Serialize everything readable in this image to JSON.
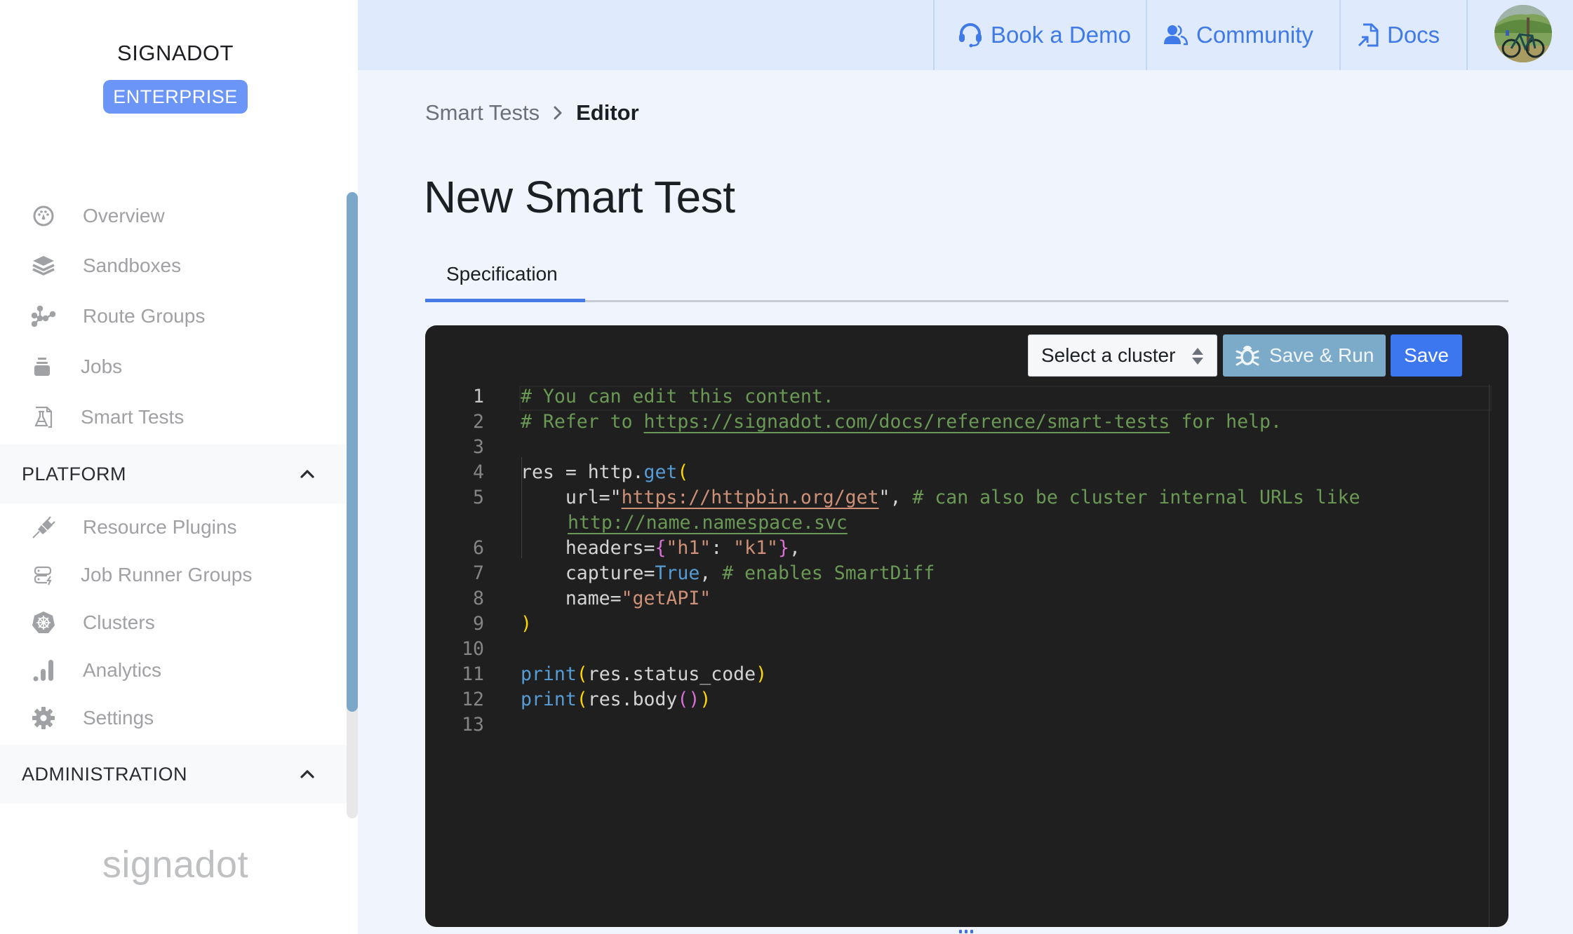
{
  "sidebar": {
    "brand": "SIGNADOT",
    "plan_badge": "ENTERPRISE",
    "items": [
      {
        "label": "Overview",
        "icon": "dashboard-gauge-icon"
      },
      {
        "label": "Sandboxes",
        "icon": "layers-icon"
      },
      {
        "label": "Route Groups",
        "icon": "graph-nodes-icon"
      },
      {
        "label": "Jobs",
        "icon": "jobs-stack-icon"
      },
      {
        "label": "Smart Tests",
        "icon": "flask-document-icon"
      }
    ],
    "platform": {
      "label": "PLATFORM",
      "expanded": true,
      "items": [
        {
          "label": "Resource Plugins",
          "icon": "plug-icon"
        },
        {
          "label": "Job Runner Groups",
          "icon": "server-bolt-icon"
        },
        {
          "label": "Clusters",
          "icon": "kubernetes-helm-icon"
        },
        {
          "label": "Analytics",
          "icon": "bar-chart-icon"
        },
        {
          "label": "Settings",
          "icon": "gear-icon"
        }
      ]
    },
    "administration": {
      "label": "ADMINISTRATION",
      "expanded": true
    },
    "footer_logo": "signadot"
  },
  "header": {
    "links": [
      {
        "label": "Book a Demo",
        "icon": "headset-icon"
      },
      {
        "label": "Community",
        "icon": "users-icon"
      },
      {
        "label": "Docs",
        "icon": "document-link-icon"
      }
    ],
    "avatar_alt": "user avatar"
  },
  "breadcrumb": {
    "parent": "Smart Tests",
    "current": "Editor"
  },
  "page_title": "New Smart Test",
  "tabs": [
    {
      "label": "Specification",
      "active": true
    }
  ],
  "editor": {
    "cluster_select": {
      "value": "Select a cluster"
    },
    "save_run_label": "Save & Run",
    "save_label": "Save",
    "line_numbers": [
      "1",
      "2",
      "3",
      "4",
      "5",
      "",
      "6",
      "7",
      "8",
      "9",
      "10",
      "11",
      "12",
      "13"
    ],
    "lines": {
      "l1": "# You can edit this content.",
      "l2_a": "# Refer to ",
      "l2_link": "https://signadot.com/docs/reference/smart-tests",
      "l2_b": " for help.",
      "l4_a": "res = http.",
      "l4_fn": "get",
      "l4_paren": "(",
      "l5_a": "    url=\"",
      "l5_url": "https://httpbin.org/get",
      "l5_b": "\", ",
      "l5_cmt": "# can also be cluster internal URLs like",
      "l5w_link": "http://name.namespace.svc",
      "l6_a": "    headers=",
      "l6_open": "{",
      "l6_s1": "\"h1\"",
      "l6_colon": ": ",
      "l6_s2": "\"k1\"",
      "l6_close": "}",
      "l6_b": ",",
      "l7_a": "    capture=",
      "l7_kw": "True",
      "l7_b": ", ",
      "l7_cmt": "# enables SmartDiff",
      "l8_a": "    name=",
      "l8_str": "\"getAPI\"",
      "l9": ")",
      "l11_fn": "print",
      "l11_open": "(",
      "l11_body": "res.status_code",
      "l11_close": ")",
      "l12_fn": "print",
      "l12_open": "(",
      "l12_body": "res.body",
      "l12_inner": "()",
      "l12_close": ")"
    }
  },
  "colors": {
    "accent": "#3d77f0",
    "badge": "#6b96f8",
    "header_bg": "#dfebfc",
    "page_bg": "#eff4fd",
    "editor_bg": "#1f1f1f",
    "save_run_bg": "#7caac9"
  }
}
